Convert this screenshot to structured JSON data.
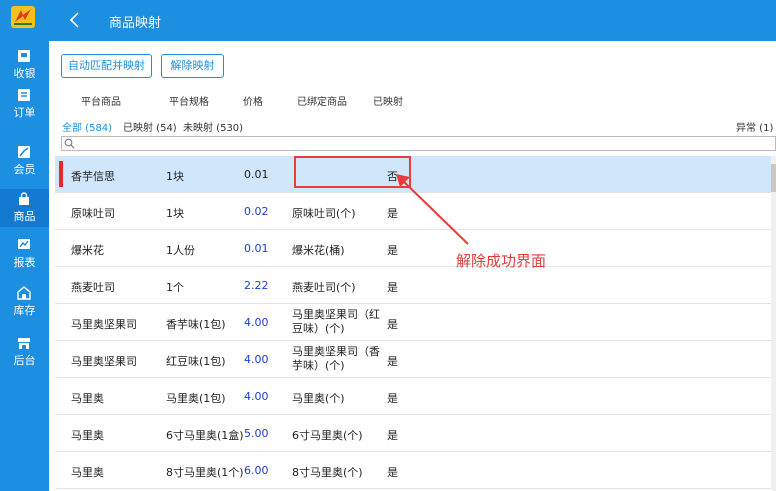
{
  "sidebar": {
    "logo_icon": "app-logo-icon",
    "items": [
      {
        "label": "收银",
        "icon": "cashier-icon"
      },
      {
        "label": "订单",
        "icon": "order-icon"
      },
      {
        "label": "会员",
        "icon": "member-icon"
      },
      {
        "label": "商品",
        "icon": "product-bag-icon",
        "active": true
      },
      {
        "label": "报表",
        "icon": "report-chart-icon"
      },
      {
        "label": "库存",
        "icon": "warehouse-icon"
      },
      {
        "label": "后台",
        "icon": "store-icon"
      }
    ]
  },
  "header": {
    "title": "商品映射",
    "back_icon": "back-arrow-icon"
  },
  "toolbar": {
    "auto_map_label": "自动匹配并映射",
    "unmap_label": "解除映射"
  },
  "columns": [
    "平台商品",
    "平台规格",
    "价格",
    "已绑定商品",
    "已映射"
  ],
  "filters": {
    "all": "全部 (584)",
    "mapped": "已映射 (54)",
    "unmapped": "未映射 (530)",
    "abnormal": "异常 (1)"
  },
  "search": {
    "placeholder": "",
    "value": ""
  },
  "rows": [
    {
      "product": "香芋信思",
      "spec": "1块",
      "price": "0.01",
      "bound": "",
      "mapped": "否",
      "selected": true
    },
    {
      "product": "原味吐司",
      "spec": "1块",
      "price": "0.02",
      "bound": "原味吐司(个)",
      "mapped": "是"
    },
    {
      "product": "爆米花",
      "spec": "1人份",
      "price": "0.01",
      "bound": "爆米花(桶)",
      "mapped": "是"
    },
    {
      "product": "燕麦吐司",
      "spec": "1个",
      "price": "2.22",
      "bound": "燕麦吐司(个)",
      "mapped": "是"
    },
    {
      "product": "马里奥坚果司",
      "spec": "香芋味(1包)",
      "price": "4.00",
      "bound": "马里奥坚果司（红豆味）(个)",
      "bound_lines": [
        "马里奥坚果司（红",
        "豆味）(个)"
      ],
      "mapped": "是"
    },
    {
      "product": "马里奥坚果司",
      "spec": "红豆味(1包)",
      "price": "4.00",
      "bound": "马里奥坚果司（香芋味）(个)",
      "bound_lines": [
        "马里奥坚果司（香",
        "芋味）(个)"
      ],
      "mapped": "是"
    },
    {
      "product": "马里奥",
      "spec": "马里奥(1包)",
      "price": "4.00",
      "bound": "马里奥(个)",
      "mapped": "是"
    },
    {
      "product": "马里奥",
      "spec": "6寸马里奥(1盒)",
      "price": "5.00",
      "bound": "6寸马里奥(个)",
      "mapped": "是"
    },
    {
      "product": "马里奥",
      "spec": "8寸马里奥(1个)",
      "price": "6.00",
      "bound": "8寸马里奥(个)",
      "mapped": "是"
    }
  ],
  "annotation": {
    "text": "解除成功界面"
  },
  "colors": {
    "brand": "#1d8fe1",
    "price": "#1a3fd0",
    "selected_row": "#cfe6fb",
    "alert": "#e83c3c"
  }
}
